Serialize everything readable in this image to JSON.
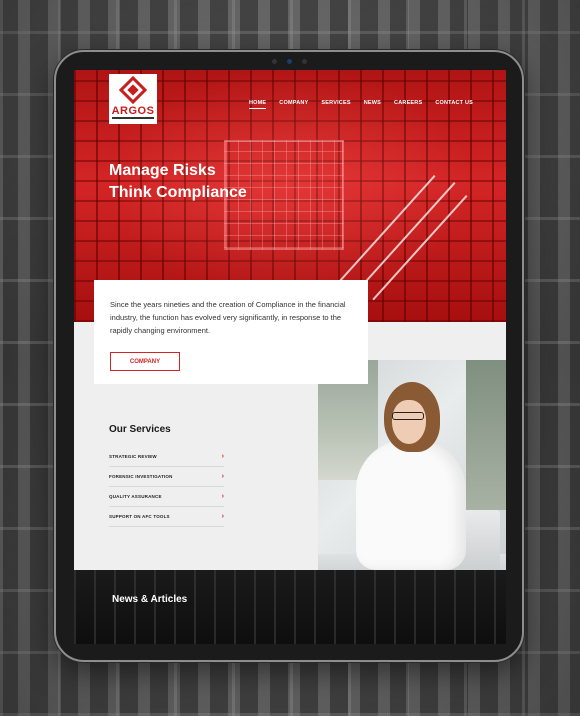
{
  "brand": {
    "logo_text": "ARGOS",
    "accent_color": "#d42525"
  },
  "nav": {
    "items": [
      {
        "label": "HOME",
        "active": true
      },
      {
        "label": "COMPANY",
        "active": false
      },
      {
        "label": "SERVICES",
        "active": false
      },
      {
        "label": "NEWS",
        "active": false
      },
      {
        "label": "CAREERS",
        "active": false
      },
      {
        "label": "CONTACT US",
        "active": false
      }
    ]
  },
  "hero": {
    "title_line1": "Manage Risks",
    "title_line2": "Think Compliance"
  },
  "intro": {
    "text": "Since the years nineties and the creation of Compliance in the financial industry, the function has evolved very significantly, in response to the rapidly changing environment.",
    "button_label": "COMPANY"
  },
  "services": {
    "heading": "Our Services",
    "items": [
      {
        "label": "STRATEGIC REVIEW",
        "icon": "chevron-right-icon"
      },
      {
        "label": "FORENSIC INVESTIGATION",
        "icon": "chevron-right-icon"
      },
      {
        "label": "QUALITY ASSURANCE",
        "icon": "chevron-right-icon"
      },
      {
        "label": "SUPPORT ON AFC TOOLS",
        "icon": "chevron-right-icon"
      }
    ]
  },
  "news": {
    "heading": "News & Articles"
  }
}
